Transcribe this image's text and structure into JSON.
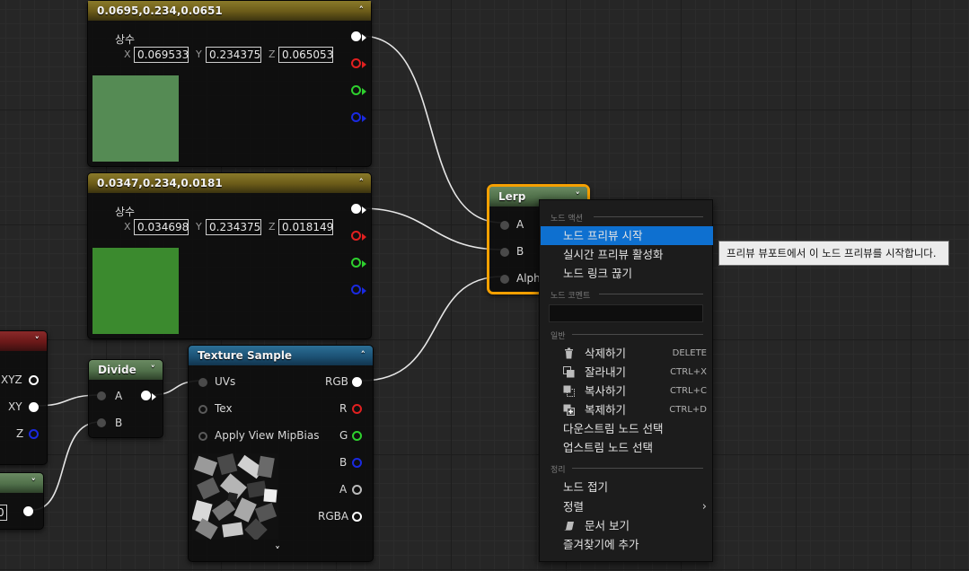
{
  "nodes": {
    "const1": {
      "title": "0.0695,0.234,0.0651",
      "label": "상수",
      "x_label": "X",
      "y_label": "Y",
      "z_label": "Z",
      "x_value": "0.069533",
      "y_value": "0.234375",
      "z_value": "0.065053",
      "swatch_color": "#558b54"
    },
    "const2": {
      "title": "0.0347,0.234,0.0181",
      "label": "상수",
      "x_label": "X",
      "y_label": "Y",
      "z_label": "Z",
      "x_value": "0.034698",
      "y_value": "0.234375",
      "z_value": "0.018149",
      "swatch_color": "#3b8a2e"
    },
    "left_partial": {
      "out_xyz": "XYZ",
      "out_xy": "XY",
      "out_z": "Z"
    },
    "left_bottom": {
      "value": "0"
    },
    "divide": {
      "title": "Divide",
      "in_a": "A",
      "in_b": "B"
    },
    "texture": {
      "title": "Texture Sample",
      "in_uvs": "UVs",
      "in_tex": "Tex",
      "in_mip": "Apply View MipBias",
      "out_rgb": "RGB",
      "out_r": "R",
      "out_g": "G",
      "out_b": "B",
      "out_a": "A",
      "out_rgba": "RGBA"
    },
    "lerp": {
      "title": "Lerp",
      "in_a": "A",
      "in_b": "B",
      "in_alpha": "Alph"
    }
  },
  "context_menu": {
    "section_node_actions": "노드 액션",
    "start_preview": "노드 프리뷰 시작",
    "enable_realtime_preview": "실시간 프리뷰 활성화",
    "break_links": "노드 링크 끊기",
    "section_node_comment": "노드 코멘트",
    "comment_value": "",
    "section_general": "일반",
    "delete": "삭제하기",
    "delete_shortcut": "DELETE",
    "cut": "잘라내기",
    "cut_shortcut": "CTRL+X",
    "copy": "복사하기",
    "copy_shortcut": "CTRL+C",
    "duplicate": "복제하기",
    "duplicate_shortcut": "CTRL+D",
    "select_downstream": "다운스트림 노드 선택",
    "select_upstream": "업스트림 노드 선택",
    "section_organize": "정리",
    "collapse_node": "노드 접기",
    "align": "정렬",
    "view_docs": "문서 보기",
    "add_favorite": "즐겨찾기에 추가"
  },
  "tooltip": "프리뷰 뷰포트에서 이 노드 프리뷰를 시작합니다.",
  "colors": {
    "pin_red": "#e02020",
    "pin_green": "#2ed02e",
    "pin_blue": "#1a2ae0",
    "lerp_selection": "#f5a000",
    "menu_highlight": "#0e70d0"
  }
}
